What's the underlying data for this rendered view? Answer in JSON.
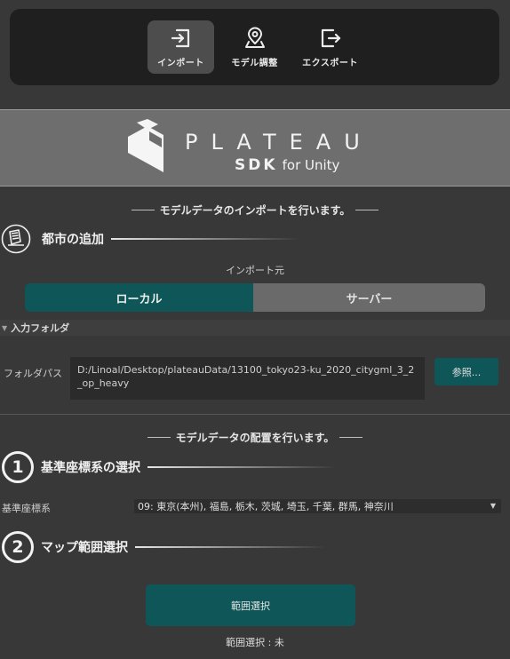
{
  "toolbar": {
    "import_label": "インポート",
    "model_label": "モデル調整",
    "export_label": "エクスポート"
  },
  "banner": {
    "brand": "PLATEAU",
    "sdk": "SDK",
    "for_unity": "for Unity"
  },
  "import_section": {
    "heading": "モデルデータのインポートを行います。",
    "add_city_title": "都市の追加",
    "source_label": "インポート元",
    "source_options": [
      "ローカル",
      "サーバー"
    ],
    "selected_source": "ローカル",
    "input_folder_foldout": "入力フォルダ",
    "folder_path_label": "フォルダパス",
    "folder_path_value": "D:/Linoal/Desktop/plateauData/13100_tokyo23-ku_2020_citygml_3_2_op_heavy",
    "browse_button": "参照..."
  },
  "placement_section": {
    "heading": "モデルデータの配置を行います。",
    "step1_number": "1",
    "step1_title": "基準座標系の選択",
    "crs_label": "基準座標系",
    "crs_value": "09: 東京(本州), 福島, 栃木, 茨城, 埼玉, 千葉, 群馬, 神奈川",
    "step2_number": "2",
    "step2_title": "マップ範囲選択",
    "range_button": "範囲選択",
    "range_status": "範囲選択 : 未"
  },
  "colors": {
    "background": "#383838",
    "accent_teal": "#0e5658",
    "toolbar_bg": "#1f1f1f",
    "banner_bg": "#6e6e6e"
  },
  "icons": [
    "import-icon",
    "model-adjust-icon",
    "export-icon",
    "plateau-logo-icon",
    "city-add-icon",
    "foldout-arrow-icon",
    "dropdown-arrow-icon"
  ]
}
